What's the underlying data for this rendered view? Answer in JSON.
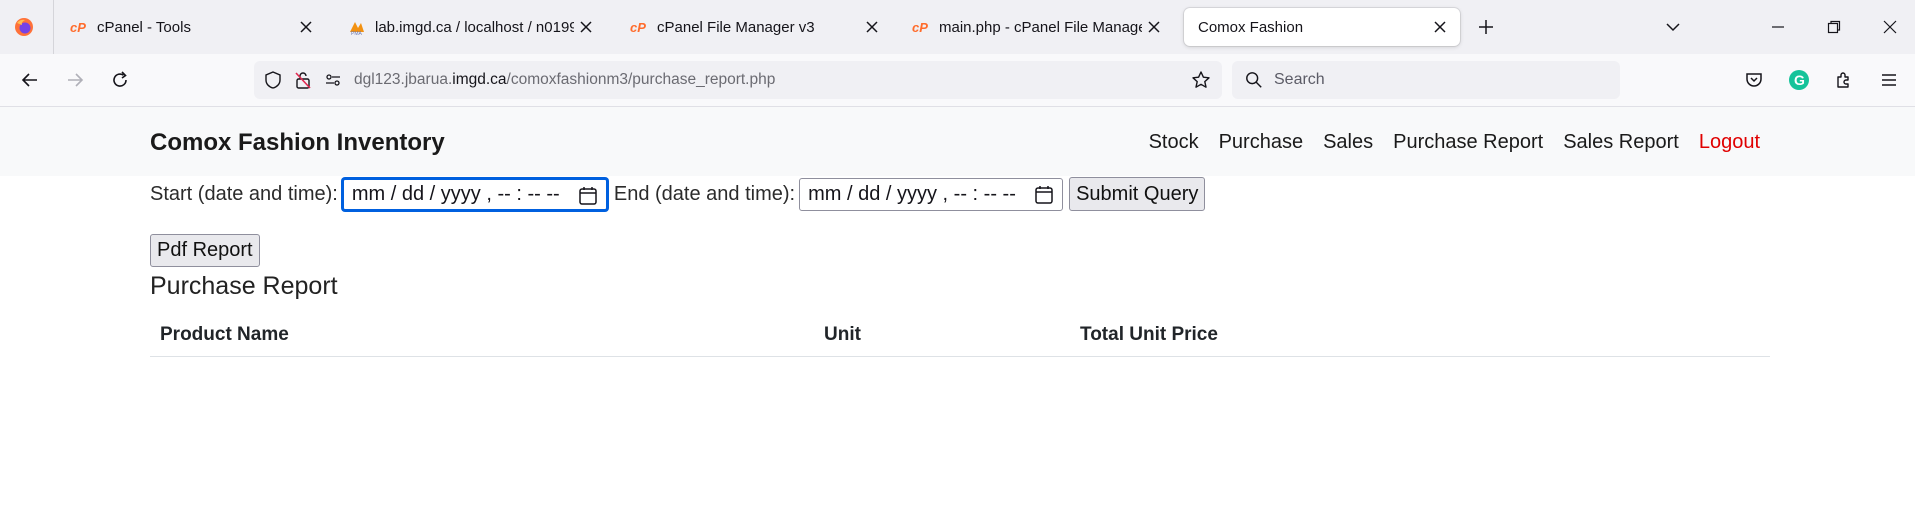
{
  "browser": {
    "tabs": [
      {
        "title": "cPanel - Tools",
        "favicon": "cpanel-icon",
        "active": false
      },
      {
        "title": "lab.imgd.ca / localhost / n0199",
        "favicon": "phpmyadmin-icon",
        "active": false
      },
      {
        "title": "cPanel File Manager v3",
        "favicon": "cpanel-icon",
        "active": false
      },
      {
        "title": "main.php - cPanel File Manager",
        "favicon": "cpanel-icon",
        "active": false
      },
      {
        "title": "Comox Fashion",
        "favicon": "",
        "active": true
      }
    ],
    "url_prefix": "dgl123.jbarua.",
    "url_host": "imgd.ca",
    "url_path": "/comoxfashionm3/purchase_report.php",
    "search_placeholder": "Search",
    "colors": {
      "tabstrip": "#f0f0f4",
      "accent": "#0060df",
      "cpanel": "#ff6c2c"
    }
  },
  "site": {
    "brand": "Comox Fashion Inventory",
    "menu": [
      "Stock",
      "Purchase",
      "Sales",
      "Purchase Report",
      "Sales Report",
      "Logout"
    ],
    "logout_color": "#e00000"
  },
  "form": {
    "start_label": "Start (date and time):",
    "end_label": "End (date and time):",
    "datetime_placeholder": "mm / dd / yyyy ,  -- : --   --",
    "submit_label": "Submit Query"
  },
  "report": {
    "pdf_button": "Pdf Report",
    "title": "Purchase Report",
    "columns": [
      "Product Name",
      "Unit",
      "Total Unit Price"
    ]
  }
}
